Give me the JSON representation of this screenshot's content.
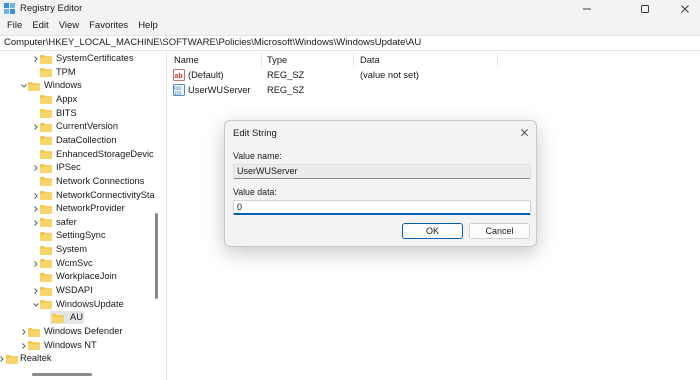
{
  "window": {
    "title": "Registry Editor",
    "controls": {
      "minimize": "—",
      "maximize": "☐",
      "close": "✕"
    }
  },
  "menu": [
    "File",
    "Edit",
    "View",
    "Favorites",
    "Help"
  ],
  "address": "Computer\\HKEY_LOCAL_MACHINE\\SOFTWARE\\Policies\\Microsoft\\Windows\\WindowsUpdate\\AU",
  "tree": [
    {
      "label": "SystemCertificates",
      "expanded": false,
      "has_children": true
    },
    {
      "label": "TPM",
      "expanded": false,
      "has_children": false
    },
    {
      "label": "Windows",
      "expanded": true,
      "has_children": true
    },
    {
      "label": "Appx",
      "expanded": false,
      "has_children": false
    },
    {
      "label": "BITS",
      "expanded": false,
      "has_children": false
    },
    {
      "label": "CurrentVersion",
      "expanded": false,
      "has_children": true
    },
    {
      "label": "DataCollection",
      "expanded": false,
      "has_children": false
    },
    {
      "label": "EnhancedStorageDevic",
      "expanded": false,
      "has_children": false
    },
    {
      "label": "IPSec",
      "expanded": false,
      "has_children": true
    },
    {
      "label": "Network Connections",
      "expanded": false,
      "has_children": false
    },
    {
      "label": "NetworkConnectivitySta",
      "expanded": false,
      "has_children": true
    },
    {
      "label": "NetworkProvider",
      "expanded": false,
      "has_children": true
    },
    {
      "label": "safer",
      "expanded": false,
      "has_children": true
    },
    {
      "label": "SettingSync",
      "expanded": false,
      "has_children": false
    },
    {
      "label": "System",
      "expanded": false,
      "has_children": false
    },
    {
      "label": "WcmSvc",
      "expanded": false,
      "has_children": true
    },
    {
      "label": "WorkplaceJoin",
      "expanded": false,
      "has_children": false
    },
    {
      "label": "WSDAPI",
      "expanded": false,
      "has_children": true
    },
    {
      "label": "WindowsUpdate",
      "expanded": true,
      "has_children": true
    },
    {
      "label": "AU",
      "expanded": false,
      "has_children": false,
      "selected": true
    },
    {
      "label": "Windows Defender",
      "expanded": false,
      "has_children": true
    },
    {
      "label": "Windows NT",
      "expanded": false,
      "has_children": true
    },
    {
      "label": "Realtek",
      "expanded": false,
      "has_children": true
    }
  ],
  "list": {
    "columns": [
      "Name",
      "Type",
      "Data"
    ],
    "rows": [
      {
        "name": "(Default)",
        "type": "REG_SZ",
        "data": "(value not set)",
        "icon": "string-value-icon"
      },
      {
        "name": "UserWUServer",
        "type": "REG_SZ",
        "data": "",
        "icon": "binary-value-icon"
      }
    ]
  },
  "dialog": {
    "title": "Edit String",
    "value_name_label": "Value name:",
    "value_name": "UserWUServer",
    "value_data_label": "Value data:",
    "value_data": "0",
    "ok_label": "OK",
    "cancel_label": "Cancel"
  },
  "colors": {
    "folder": "#f5c54a",
    "accent": "#005fb8",
    "chrome": "#f3f3f3"
  }
}
